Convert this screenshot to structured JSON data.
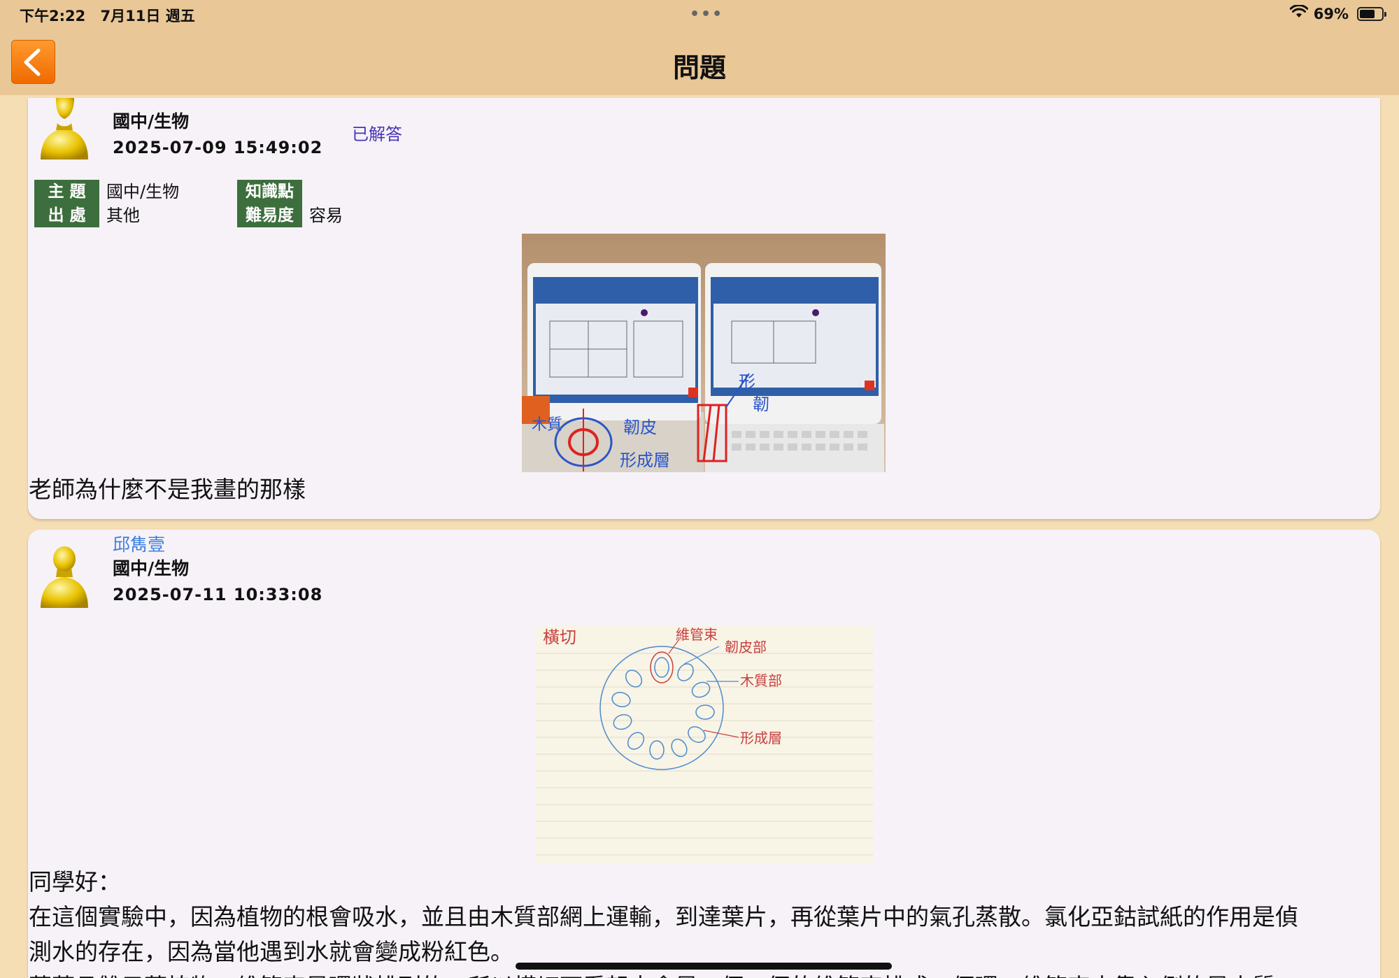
{
  "status_bar": {
    "time": "下午2:22",
    "date": "7月11日 週五",
    "dots": "•••",
    "battery_percent": "69%",
    "battery_level": 0.69
  },
  "nav": {
    "title": "問題"
  },
  "question": {
    "subject": "國中/生物",
    "timestamp": "2025-07-09 15:49:02",
    "status": "已解答",
    "info": {
      "topic_label": "主 題",
      "topic_value": "國中/生物",
      "source_label": "出 處",
      "source_value": "其他",
      "knowledge_label": "知識點",
      "knowledge_value": "",
      "difficulty_label": "難易度",
      "difficulty_value": "容易"
    },
    "photo_annotations": [
      "木質",
      "韌皮",
      "形成層",
      "形",
      "韌"
    ],
    "text": "老師為什麼不是我畫的那樣"
  },
  "answer": {
    "author": "邱雋壹",
    "subject": "國中/生物",
    "timestamp": "2025-07-11 10:33:08",
    "sketch_labels": {
      "cut": "橫切",
      "bundle": "維管束",
      "phloem": "韌皮部",
      "xylem": "木質部",
      "cambium": "形成層"
    },
    "text_lines": [
      "同學好：",
      "在這個實驗中，因為植物的根會吸水，並且由木質部網上運輸，到達葉片，再從葉片中的氣孔蒸散。氯化亞鈷試紙的作用是偵",
      "測水的存在，因為當他遇到水就會變成粉紅色。",
      "莖葉且雙子葉植物，維管束是環狀排列的，所以橫切面看起來會是一個一個的維管束排成一個環，維管束中靠內側的是木質"
    ]
  }
}
